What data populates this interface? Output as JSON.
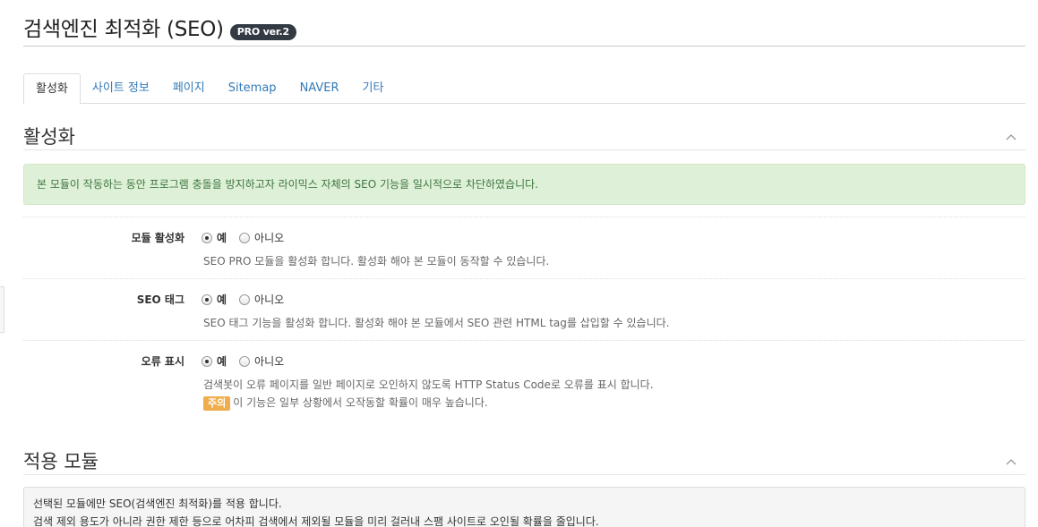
{
  "header": {
    "title": "검색엔진 최적화 (SEO)",
    "badge": "PRO ver.2"
  },
  "tabs": [
    {
      "label": "활성화",
      "active": true
    },
    {
      "label": "사이트 정보",
      "active": false
    },
    {
      "label": "페이지",
      "active": false
    },
    {
      "label": "Sitemap",
      "active": false
    },
    {
      "label": "NAVER",
      "active": false
    },
    {
      "label": "기타",
      "active": false
    }
  ],
  "activation_section": {
    "title": "활성화",
    "collapse_icon": "chevron-up-icon",
    "notice": "본 모듈이 작동하는 동안 프로그램 충돌을 방지하고자 라이믹스 자체의 SEO 기능을 일시적으로 차단하였습니다.",
    "settings": [
      {
        "label": "모듈 활성화",
        "options": [
          "예",
          "아니오"
        ],
        "selected": "예",
        "help": "SEO PRO 모듈을 활성화 합니다. 활성화 해야 본 모듈이 동작할 수 있습니다."
      },
      {
        "label": "SEO 태그",
        "options": [
          "예",
          "아니오"
        ],
        "selected": "예",
        "help": "SEO 태그 기능을 활성화 합니다. 활성화 해야 본 모듈에서 SEO 관련 HTML tag를 삽입할 수 있습니다."
      },
      {
        "label": "오류 표시",
        "options": [
          "예",
          "아니오"
        ],
        "selected": "예",
        "help": "검색봇이 오류 페이지를 일반 페이지로 오인하지 않도록 HTTP Status Code로 오류를 표시 합니다.",
        "caution_label": "주의",
        "caution_text": "이 기능은 일부 상황에서 오작동할 확률이 매우 높습니다."
      }
    ]
  },
  "modules_section": {
    "title": "적용 모듈",
    "collapse_icon": "chevron-up-icon",
    "info_line1": "선택된 모듈에만 SEO(검색엔진 최적화)를 적용 합니다.",
    "info_line2": "검색 제외 용도가 아니라 권한 제한 등으로 어차피 검색에서 제외될 모듈을 미리 걸러내 스팸 사이트로 오인될 확률을 줄입니다."
  },
  "colors": {
    "link": "#337ab7",
    "success_bg": "#dff0d8",
    "success_text": "#3c763d",
    "caution": "#f0ad4e",
    "badge_bg": "#333a44"
  }
}
